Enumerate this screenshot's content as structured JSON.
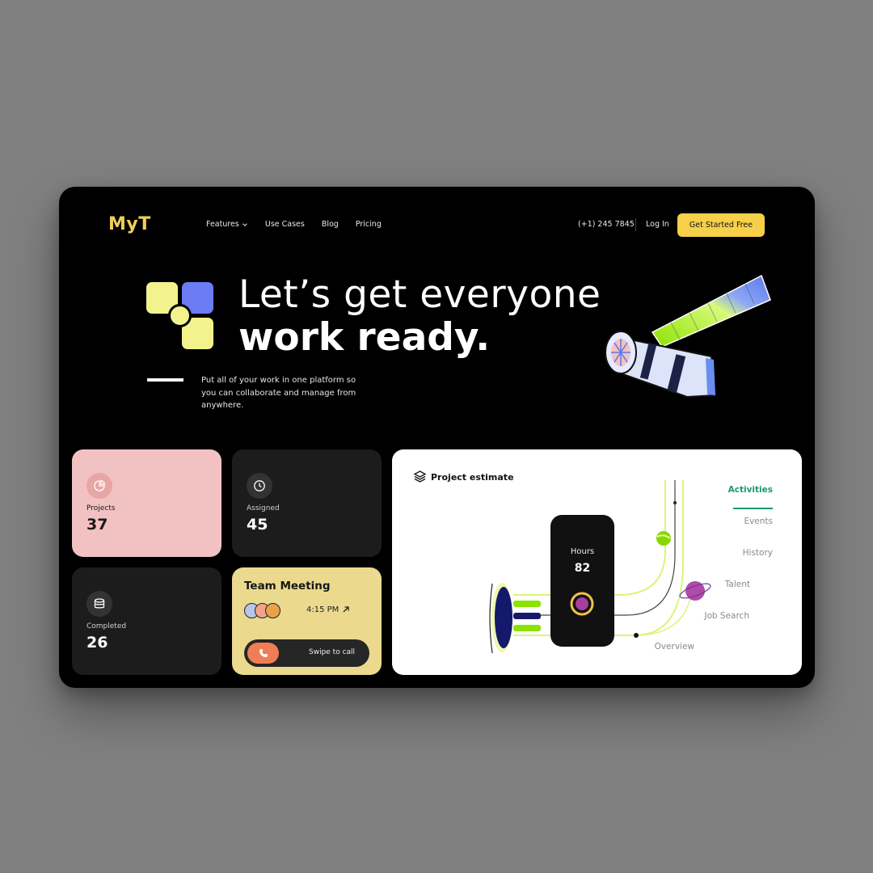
{
  "nav": {
    "logo": "MyT",
    "items": [
      {
        "label": "Features",
        "has_dropdown": true
      },
      {
        "label": "Use Cases"
      },
      {
        "label": "Blog"
      },
      {
        "label": "Pricing"
      }
    ],
    "phone": "(+1) 245 7845",
    "login": "Log In",
    "cta": "Get Started Free"
  },
  "hero": {
    "headline_line1": "Let’s get everyone",
    "headline_line2": "work ready.",
    "subtext": "Put all of your work in one platform so you can collaborate and manage from anywhere."
  },
  "stats": {
    "projects": {
      "label": "Projects",
      "value": "37",
      "icon": "pie-chart-icon"
    },
    "assigned": {
      "label": "Assigned",
      "value": "45",
      "icon": "clock-icon"
    },
    "completed": {
      "label": "Completed",
      "value": "26",
      "icon": "database-icon"
    }
  },
  "meeting": {
    "title": "Team Meeting",
    "time": "4:15 PM",
    "swipe_label": "Swipe to call",
    "avatar_count": 3
  },
  "estimate": {
    "title": "Project estimate",
    "hours_label": "Hours",
    "hours_value": "82",
    "menu": [
      "Activities",
      "Events",
      "History",
      "Talent",
      "Job Search",
      "Overview"
    ],
    "active_menu": "Activities"
  },
  "colors": {
    "background": "#808080",
    "frame": "#000000",
    "brand_yellow": "#f7d04a",
    "projects_card": "#f2c1c1",
    "meeting_card": "#ebd98e",
    "accent_green": "#1a9a6b",
    "call_orange": "#ef7d56"
  }
}
